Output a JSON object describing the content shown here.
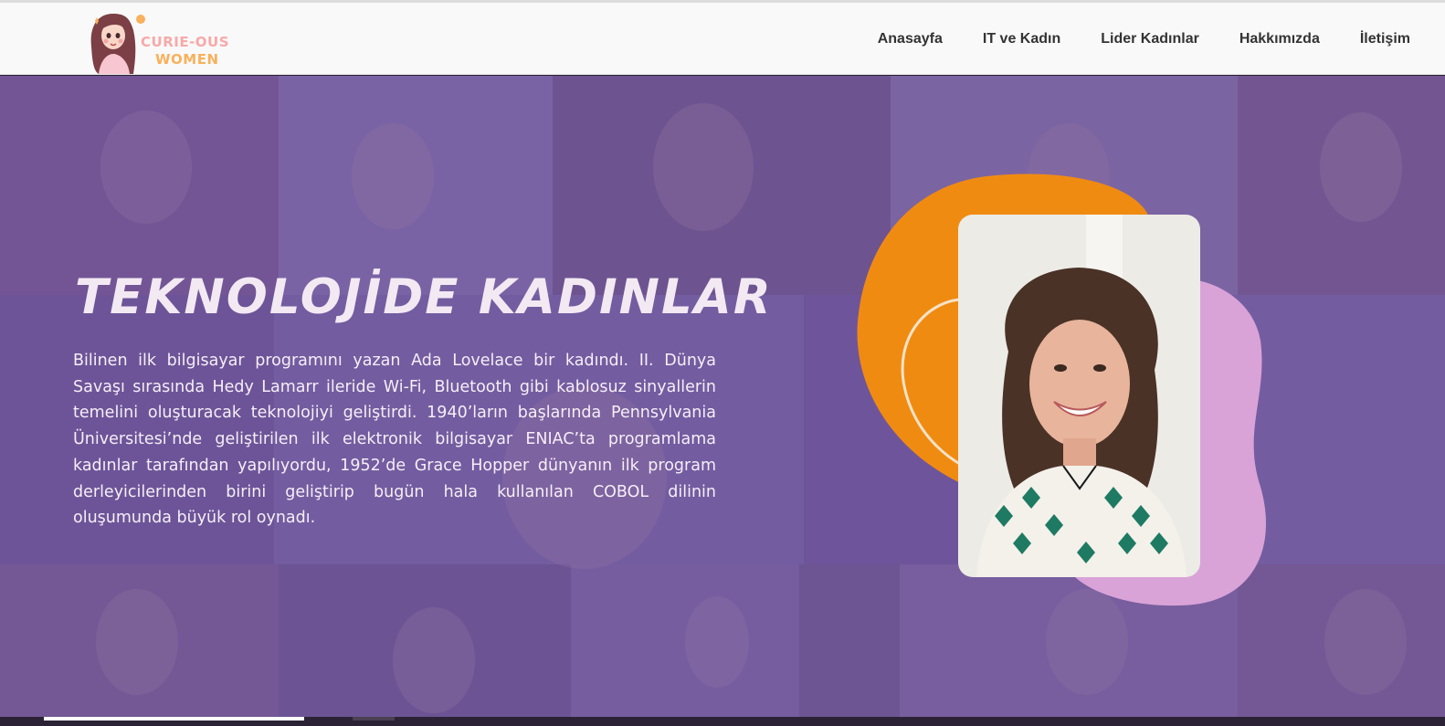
{
  "logo": {
    "line1": "CURIE-OUS",
    "line2": "WOMEN"
  },
  "nav": {
    "items": [
      {
        "label": "Anasayfa"
      },
      {
        "label": "IT ve Kadın"
      },
      {
        "label": "Lider Kadınlar"
      },
      {
        "label": "Hakkımızda"
      },
      {
        "label": "İletişim"
      }
    ]
  },
  "hero": {
    "title": "TEKNOLOJİDE KADINLAR",
    "text": "Bilinen ilk bilgisayar programını yazan Ada Lovelace bir kadındı. II. Dünya Savaşı sırasında Hedy Lamarr ileride Wi-Fi, Bluetooth gibi kablosuz sinyallerin temelini oluşturacak teknolojiyi geliştirdi. 1940’ların başlarında Pennsylvania Üniversitesi’nde geliştirilen ilk elektronik bilgisayar ENIAC’ta programlama kadınlar tarafından yapılıyordu, 1952’de Grace Hopper dünyanın ilk program derleyicilerinden birini geliştirip bugün hala kullanılan COBOL dilinin oluşumunda büyük rol oynadı."
  },
  "colors": {
    "hero_bg": "#6b4f97",
    "orange_blob": "#f08b12",
    "pink_blob": "#d9a3d8",
    "header_bg": "#f9f9f9"
  }
}
